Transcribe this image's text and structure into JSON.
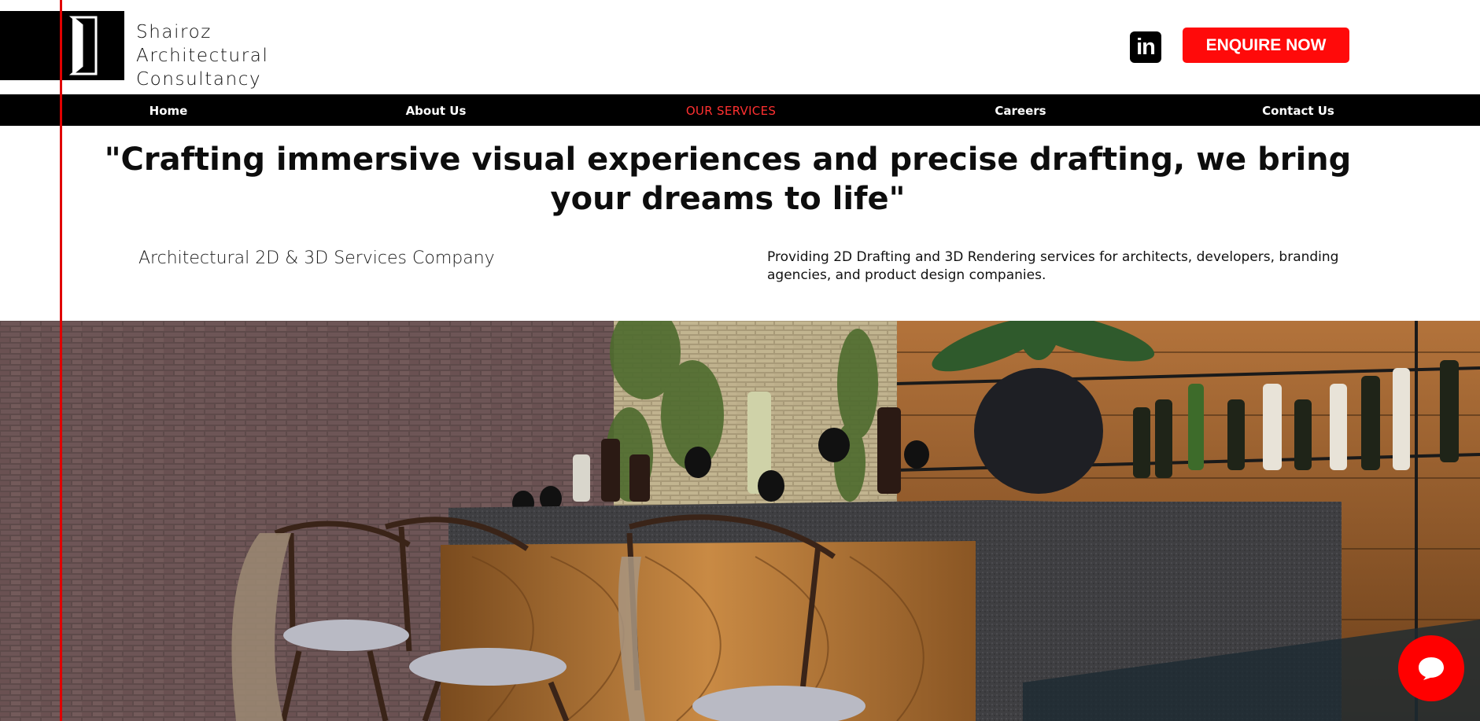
{
  "brand": {
    "name_lines": [
      "Shairoz",
      "Architectural",
      "Consultancy"
    ]
  },
  "header": {
    "linkedin_label": "in",
    "enquire_label": "ENQUIRE NOW"
  },
  "nav": {
    "items": [
      {
        "label": "Home"
      },
      {
        "label": "About Us"
      },
      {
        "label": "OUR SERVICES",
        "active": true
      },
      {
        "label": "Careers"
      },
      {
        "label": "Contact Us"
      }
    ]
  },
  "intro": {
    "headline": "\"Crafting immersive visual experiences and precise drafting, we bring your dreams to life\"",
    "subtitle": "Architectural 2D & 3D Services Company",
    "description": "Providing 2D Drafting and 3D Rendering services for architects, developers, branding agencies, and product design companies."
  },
  "hero": {
    "icon": "render-scene-bar-interior"
  },
  "colors": {
    "accent": "#ff0a0a",
    "nav_bg": "#000000",
    "active_nav": "#ff3030"
  },
  "chat": {
    "icon": "chat-bubble-icon"
  }
}
